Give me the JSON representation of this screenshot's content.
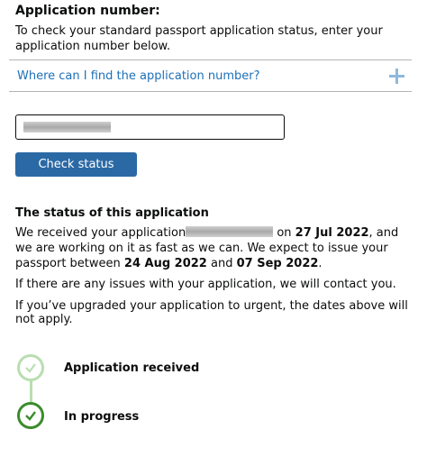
{
  "application_number": {
    "heading": "Application number:",
    "intro": "To check your standard passport application status, enter your application number below.",
    "help_link": "Where can I find the application number?",
    "check_button": "Check status"
  },
  "status": {
    "heading": "The status of this application",
    "received_prefix": "We received your application",
    "received_on": " on ",
    "received_date": "27 Jul 2022",
    "received_suffix": ", and we are working on it as fast as we can. We expect to issue your passport between ",
    "issue_start": "24 Aug 2022",
    "and": " and ",
    "issue_end": "07 Sep 2022",
    "period": ".",
    "issues_text": "If there are any issues with your application, we will contact you.",
    "urgent_text": "If you’ve upgraded your application to urgent, the dates above will not apply."
  },
  "progress": {
    "steps": [
      {
        "label": "Application received",
        "state": "complete",
        "color": "#b9deb0"
      },
      {
        "label": "In progress",
        "state": "current",
        "color": "#3b8c2b"
      }
    ]
  },
  "colors": {
    "link": "#1d70b8",
    "button": "#2b69a5",
    "accordion_icon": "#8eb8dc"
  },
  "icons": {
    "accordion": "plus-icon",
    "step": "check-icon"
  }
}
